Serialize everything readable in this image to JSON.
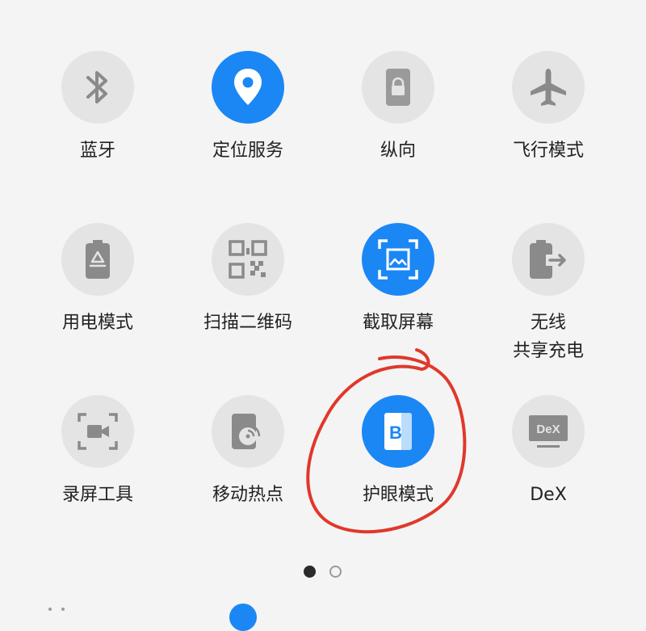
{
  "tiles": [
    {
      "label": "蓝牙",
      "icon": "bluetooth-icon",
      "active": false
    },
    {
      "label": "定位服务",
      "icon": "location-pin-icon",
      "active": true
    },
    {
      "label": "纵向",
      "icon": "portrait-lock-icon",
      "active": false
    },
    {
      "label": "飞行模式",
      "icon": "airplane-icon",
      "active": false
    },
    {
      "label": "用电模式",
      "icon": "battery-recycle-icon",
      "active": false
    },
    {
      "label": "扫描二维码",
      "icon": "qr-code-icon",
      "active": false
    },
    {
      "label": "截取屏幕",
      "icon": "screenshot-icon",
      "active": true
    },
    {
      "label": "无线\n共享充电",
      "icon": "wireless-powershare-icon",
      "active": false
    },
    {
      "label": "录屏工具",
      "icon": "screen-recorder-icon",
      "active": false
    },
    {
      "label": "移动热点",
      "icon": "mobile-hotspot-icon",
      "active": false
    },
    {
      "label": "护眼模式",
      "icon": "eye-comfort-icon",
      "active": true
    },
    {
      "label": "DeX",
      "icon": "dex-icon",
      "active": false
    }
  ],
  "dex_icon_text": "DeX",
  "eye_icon_text": "B",
  "pagination": {
    "current": 1,
    "total": 2
  },
  "colors": {
    "accent": "#1b87f5",
    "inactive_bg": "#e4e4e4",
    "icon_gray": "#8a8a8a",
    "annotation": "#e0382b"
  }
}
